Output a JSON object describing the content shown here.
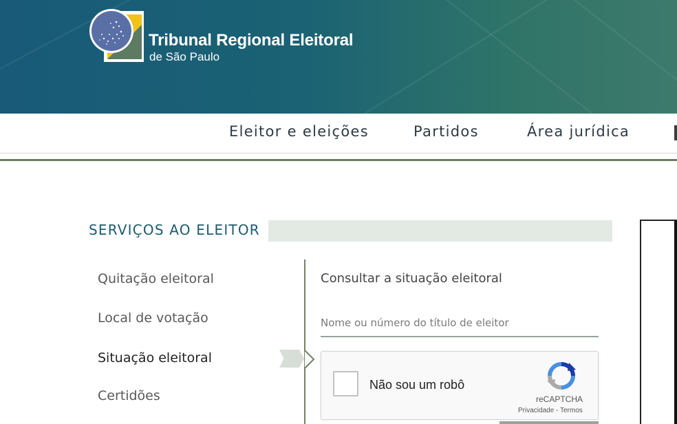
{
  "header": {
    "title": "Tribunal Regional Eleitoral",
    "subtitle": "de São Paulo",
    "logo_icon": "tre-sp-logo-icon",
    "colors": {
      "gradient_start": "#185a78",
      "gradient_end": "#3d7a6c",
      "logo_yellow": "#f2c21b",
      "logo_blue": "#5a6fa6"
    }
  },
  "nav": {
    "items": [
      {
        "label": "Eleitor e eleições"
      },
      {
        "label": "Partidos"
      },
      {
        "label": "Área jurídica"
      }
    ]
  },
  "section": {
    "title": "SERVIÇOS AO ELEITOR"
  },
  "menu": {
    "items": [
      {
        "label": "Quitação eleitoral"
      },
      {
        "label": "Local de votação"
      },
      {
        "label": "Situação eleitoral",
        "active": true
      },
      {
        "label": "Certidões"
      }
    ]
  },
  "panel": {
    "title": "Consultar a situação eleitoral",
    "search_placeholder": "Nome ou número do título de eleitor",
    "search_value": ""
  },
  "recaptcha": {
    "checkbox_label": "Não sou um robô",
    "brand": "reCAPTCHA",
    "privacy": "Privacidade",
    "separator": " - ",
    "terms": "Termos",
    "checked": false
  }
}
